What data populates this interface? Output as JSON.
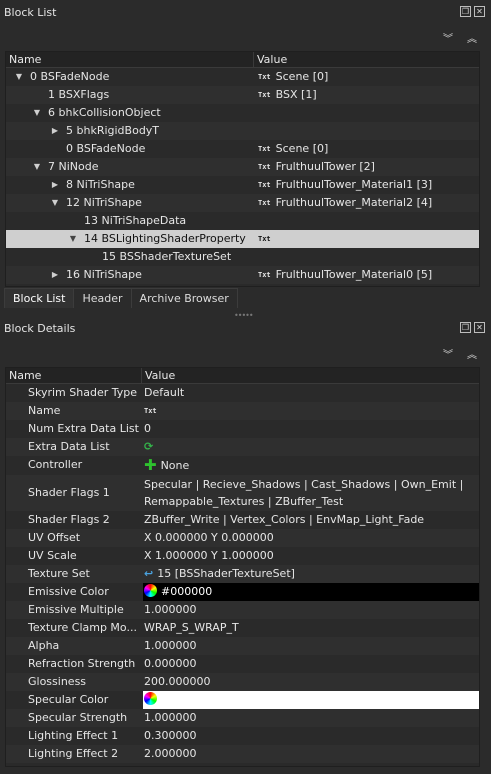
{
  "block_list": {
    "title": "Block List",
    "columns": [
      "Name",
      "Value"
    ],
    "rows": [
      {
        "name": "0 BSFadeNode",
        "value": "Scene [0]",
        "txt": "Txt",
        "expander": "expanded"
      },
      {
        "name": "1 BSXFlags",
        "value": "BSX [1]",
        "txt": "Txt",
        "expander": ""
      },
      {
        "name": "6 bhkCollisionObject",
        "value": "",
        "txt": "",
        "expander": "expanded"
      },
      {
        "name": "5 bhkRigidBodyT",
        "value": "",
        "txt": "",
        "expander": "collapsed"
      },
      {
        "name": "0 BSFadeNode",
        "value": "Scene [0]",
        "txt": "Txt",
        "expander": ""
      },
      {
        "name": "7 NiNode",
        "value": "FrulthuulTower [2]",
        "txt": "Txt",
        "expander": "expanded"
      },
      {
        "name": "8 NiTriShape",
        "value": "FrulthuulTower_Material1 [3]",
        "txt": "Txt",
        "expander": "collapsed"
      },
      {
        "name": "12 NiTriShape",
        "value": "FrulthuulTower_Material2 [4]",
        "txt": "Txt",
        "expander": "expanded"
      },
      {
        "name": "13 NiTriShapeData",
        "value": "",
        "txt": "",
        "expander": ""
      },
      {
        "name": "14 BSLightingShaderProperty",
        "value": "",
        "txt": "Txt",
        "expander": "expanded"
      },
      {
        "name": "15 BSShaderTextureSet",
        "value": "",
        "txt": "",
        "expander": ""
      },
      {
        "name": "16 NiTriShape",
        "value": "FrulthuulTower_Material0 [5]",
        "txt": "Txt",
        "expander": "collapsed"
      }
    ],
    "tabs": [
      "Block List",
      "Header",
      "Archive Browser"
    ]
  },
  "block_details": {
    "title": "Block Details",
    "columns": [
      "Name",
      "Value"
    ],
    "rows": [
      {
        "name": "Skyrim Shader Type",
        "value": "Default"
      },
      {
        "name": "Name",
        "value": "",
        "txt": "Txt"
      },
      {
        "name": "Num Extra Data List",
        "value": "0"
      },
      {
        "name": "Extra Data List",
        "value": ""
      },
      {
        "name": "Controller",
        "value": "None"
      },
      {
        "name": "Shader Flags 1",
        "value": "Specular | Recieve_Shadows | Cast_Shadows | Own_Emit | Remappable_Textures | ZBuffer_Test"
      },
      {
        "name": "Shader Flags 2",
        "value": "ZBuffer_Write | Vertex_Colors | EnvMap_Light_Fade"
      },
      {
        "name": "UV Offset",
        "value": "X 0.000000 Y 0.000000"
      },
      {
        "name": "UV Scale",
        "value": "X 1.000000 Y 1.000000"
      },
      {
        "name": "Texture Set",
        "value": "15 [BSShaderTextureSet]"
      },
      {
        "name": "Emissive Color",
        "value": "#000000"
      },
      {
        "name": "Emissive Multiple",
        "value": "1.000000"
      },
      {
        "name": "Texture Clamp Mo...",
        "value": "WRAP_S_WRAP_T"
      },
      {
        "name": "Alpha",
        "value": "1.000000"
      },
      {
        "name": "Refraction Strength",
        "value": "0.000000"
      },
      {
        "name": "Glossiness",
        "value": "200.000000"
      },
      {
        "name": "Specular Color",
        "value": ""
      },
      {
        "name": "Specular Strength",
        "value": "1.000000"
      },
      {
        "name": "Lighting Effect 1",
        "value": "0.300000"
      },
      {
        "name": "Lighting Effect 2",
        "value": "2.000000"
      }
    ]
  },
  "colors": {
    "background": "#2b2b2b",
    "selection": "#cfcfcf",
    "emissive_swatch": "#000000",
    "specular_swatch": "#ffffff",
    "add_icon": "#2ec22e"
  },
  "icons": [
    "float-icon",
    "close-icon",
    "collapse-all-icon",
    "expand-all-icon",
    "txt-icon",
    "color-wheel-icon",
    "add-icon",
    "refresh-icon",
    "link-icon"
  ]
}
